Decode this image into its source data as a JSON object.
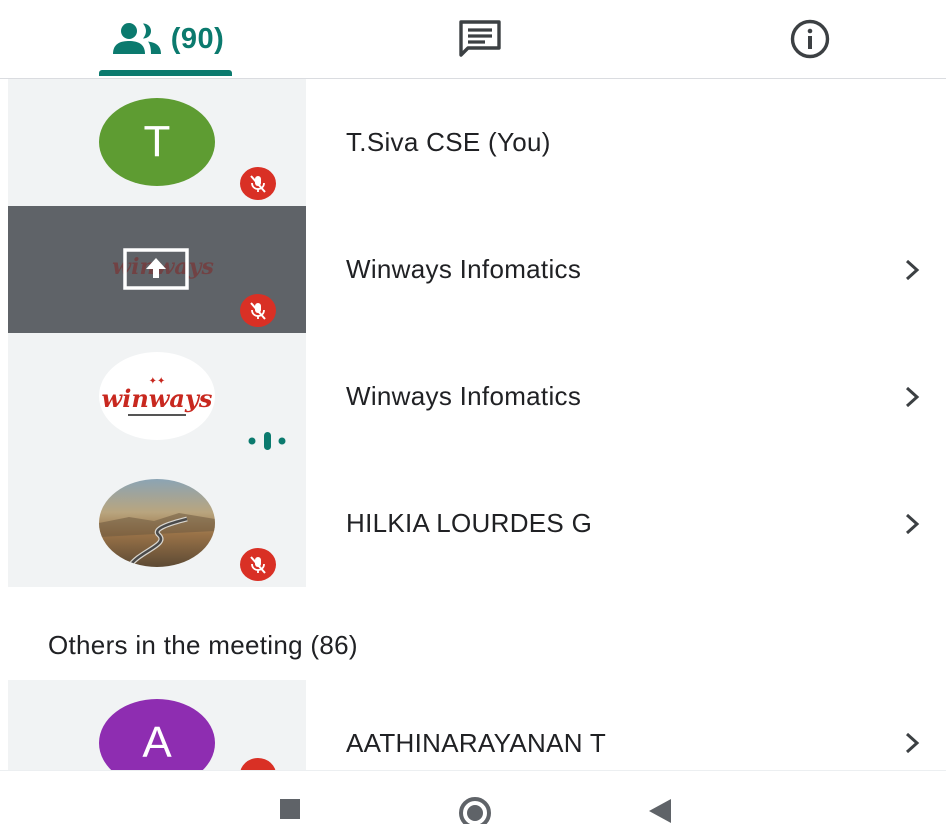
{
  "tabs": {
    "people": {
      "icon": "people-icon",
      "count_label": "(90)"
    },
    "chat": {
      "icon": "chat-icon"
    },
    "info": {
      "icon": "info-icon"
    },
    "accent_color": "#0b7a6e"
  },
  "participants": [
    {
      "name": "T.Siva CSE (You)",
      "avatar": {
        "type": "initial",
        "letter": "T",
        "color": "#5e9c32"
      },
      "status": "muted",
      "has_chevron": false
    },
    {
      "name": "Winways Infomatics",
      "avatar": {
        "type": "presenting",
        "icon": "present-screen-icon",
        "logo_text": "winways"
      },
      "status": "muted",
      "has_chevron": true
    },
    {
      "name": "Winways Infomatics",
      "avatar": {
        "type": "logo",
        "logo_text": "winways"
      },
      "status": "speaking",
      "has_chevron": true
    },
    {
      "name": "HILKIA LOURDES G",
      "avatar": {
        "type": "photo",
        "icon": "road-photo"
      },
      "status": "muted",
      "has_chevron": true
    }
  ],
  "others_heading": "Others in the meeting (86)",
  "others": [
    {
      "name": "AATHINARAYANAN T",
      "avatar": {
        "type": "initial",
        "letter": "A",
        "color": "#8e2db1"
      },
      "status": "muted",
      "has_chevron": true
    }
  ],
  "navbar": {
    "buttons": [
      "recents-icon",
      "home-icon",
      "back-icon"
    ]
  },
  "colors": {
    "mute_badge": "#d93025",
    "speaking": "#0b7a6e",
    "tile_background": "#f1f3f4",
    "presenting_tile": "#5f6368"
  }
}
